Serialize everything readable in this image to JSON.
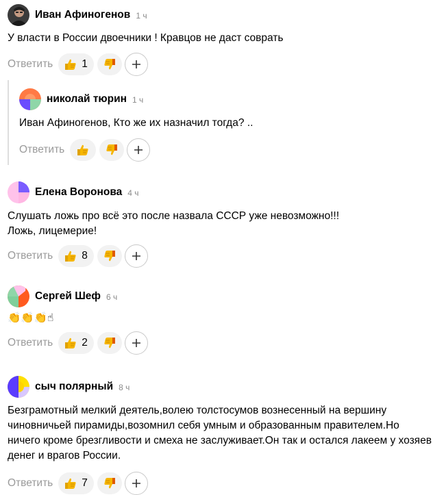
{
  "comments": [
    {
      "author": "Иван Афиногенов",
      "time": "1 ч",
      "text": "У власти в России двоечники ! Кравцов не даст соврать",
      "reply_label": "Ответить",
      "likes": "1",
      "avatar": "photo-avatar"
    },
    {
      "author": "николай тюрин",
      "time": "1 ч",
      "text": "Иван Афиногенов, Кто же их назначил тогда? ..",
      "reply_label": "Ответить",
      "likes": "",
      "avatar": "generated-avatar",
      "is_reply": true
    },
    {
      "author": "Елена Воронова",
      "time": "4 ч",
      "text": "Слушать ложь про всё это после назвала СССР уже невозможно!!!\nЛожь, лицемерие!",
      "reply_label": "Ответить",
      "likes": "8",
      "avatar": "generated-avatar"
    },
    {
      "author": "Сергей Шеф",
      "time": "6 ч",
      "text": "👏👏👏☝",
      "reply_label": "Ответить",
      "likes": "2",
      "avatar": "generated-avatar"
    },
    {
      "author": "сыч полярный",
      "time": "8 ч",
      "text": "Безграмотный мелкий деятель,волею толстосумов вознесенный на вершину\nчиновничьей пирамиды,возомнил себя умным и образованным правителем.Но\nничего кроме брезгливости и смеха не заслуживает.Он так и остался лакеем у хозяев\nденег и врагов России.",
      "reply_label": "Ответить",
      "likes": "7",
      "avatar": "generated-avatar"
    }
  ],
  "icons": {
    "like": "thumbs-up-icon",
    "dislike": "thumbs-down-icon",
    "more": "plus-icon"
  },
  "colors": {
    "action_grey": "#9a9a9a",
    "pill_bg": "#f2f2f2",
    "thumb_yellow": "#f6b600"
  }
}
